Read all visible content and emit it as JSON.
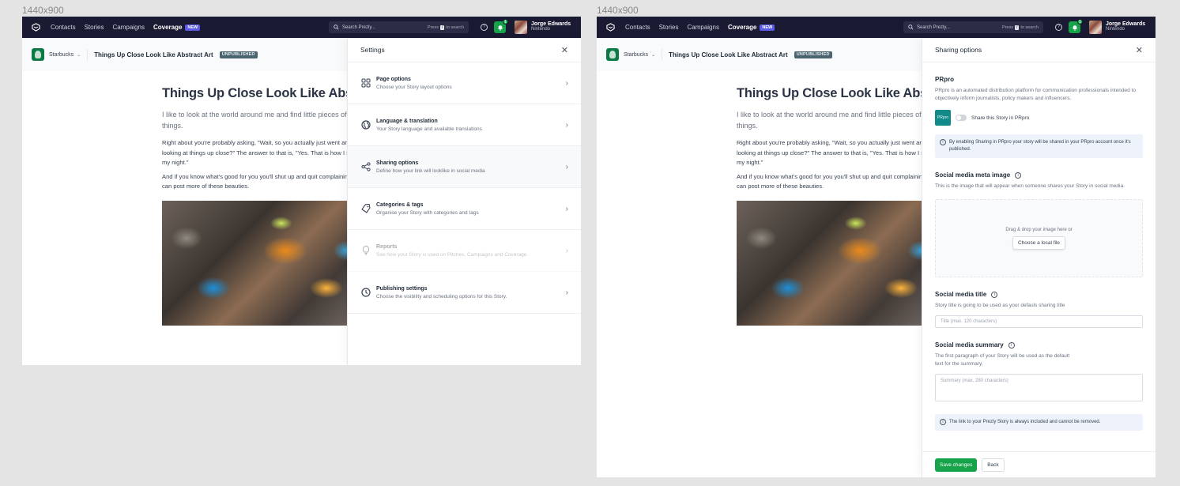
{
  "frames": {
    "left_label": "1440x900",
    "right_label": "1440x900"
  },
  "topnav": {
    "items": [
      "Contacts",
      "Stories",
      "Campaigns",
      "Coverage"
    ],
    "new_badge": "NEW",
    "search_placeholder": "Search Prezly...",
    "search_hint_pre": "Press",
    "search_hint_key": "/",
    "search_hint_post": "to search",
    "help": "?",
    "notifications_count": "1",
    "user_name": "Jorge Edwards",
    "user_org": "Nintendo"
  },
  "subheader": {
    "brand": "Starbucks",
    "story_title": "Things Up Close Look Like Abstract Art",
    "status": "UNPUBLISHED"
  },
  "article": {
    "title": "Things Up Close Look Like Abstract Art",
    "lead": "I like to look at the world around me and find little pieces of larger things.",
    "paragraphs": [
      "Right about you're probably asking, \"Wait, so you actually just went around looking at things up close?\" The answer to that is, \"Yes. That is how I spent my night.\"",
      "And if you know what's good for you you'll shut up and quit complaining so I can post more of these beauties."
    ]
  },
  "settings": {
    "title": "Settings",
    "items": [
      {
        "icon": "layout-icon",
        "title": "Page options",
        "desc": "Choose your Story layout options"
      },
      {
        "icon": "globe-icon",
        "title": "Language & translation",
        "desc": "Your Story language and available translations"
      },
      {
        "icon": "share-icon",
        "title": "Sharing options",
        "desc": "Define how your link will looklike in social media"
      },
      {
        "icon": "tag-icon",
        "title": "Categories & tags",
        "desc": "Organise your Story with categories and tags"
      },
      {
        "icon": "lightbulb-icon",
        "title": "Reports",
        "desc": "See how your Story is used on Pitches, Campaigns and Coverage."
      },
      {
        "icon": "clock-icon",
        "title": "Publishing settings",
        "desc": "Choose the visibility and scheduling options for this Story."
      }
    ]
  },
  "sharing": {
    "title": "Sharing options",
    "prpro_title": "PRpro",
    "prpro_desc": "PRpro is an automated distribution platform for communication professionals intended to objectively inform journalists, policy makers and influencers.",
    "prpro_logo": "PRpro",
    "toggle_label": "Share this Story in PRpro",
    "toggle_on": false,
    "prpro_callout": "By enabling Sharing in PRpro your story will be shared in your PRpro account once it's published.",
    "image_title": "Social media meta image",
    "image_desc": "This is the image that will appear when someone shares your Story in social media.",
    "dropzone_text": "Drag & drop your image here or",
    "choose_file": "Choose a local file",
    "title_label": "Social media title",
    "title_desc": "Story title is going to be used as your defauls sharing title",
    "title_placeholder": "Title (max. 120 characters)",
    "summary_label": "Social media summary",
    "summary_desc": "The first paragraph of your Story will be used as the default text for the summary.",
    "summary_placeholder": "Summary (max. 280 characters)",
    "link_callout": "The link to your Prezly Story is always included and cannot be removed.",
    "save": "Save changes",
    "back": "Back"
  }
}
